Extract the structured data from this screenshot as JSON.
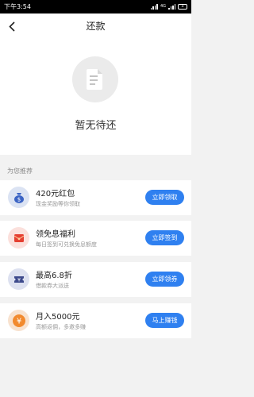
{
  "status_bar": {
    "time": "下午3:54",
    "net": "4G",
    "battery": "3"
  },
  "nav": {
    "title": "还款"
  },
  "empty_state": {
    "text": "暂无待还"
  },
  "recommend": {
    "label": "为您推荐",
    "cards": [
      {
        "title": "420元红包",
        "subtitle": "现金奖励等你领取",
        "button": "立即领取",
        "icon": "money-bag-icon",
        "icon_bg": "#dbe3f3"
      },
      {
        "title": "领免息福利",
        "subtitle": "每日签到可兑换免息额度",
        "button": "立即签到",
        "icon": "red-envelope-icon",
        "icon_bg": "#fbe0dc"
      },
      {
        "title": "最高6.8折",
        "subtitle": "借款券大派送",
        "button": "立即领券",
        "icon": "coupon-icon",
        "icon_bg": "#dde1f0"
      },
      {
        "title": "月入5000元",
        "subtitle": "高额返佣，多邀多赚",
        "button": "马上赚钱",
        "icon": "yuan-coin-icon",
        "icon_bg": "#f8e2cf"
      }
    ]
  },
  "colors": {
    "accent": "#2f80f0",
    "background": "#f2f2f2"
  }
}
